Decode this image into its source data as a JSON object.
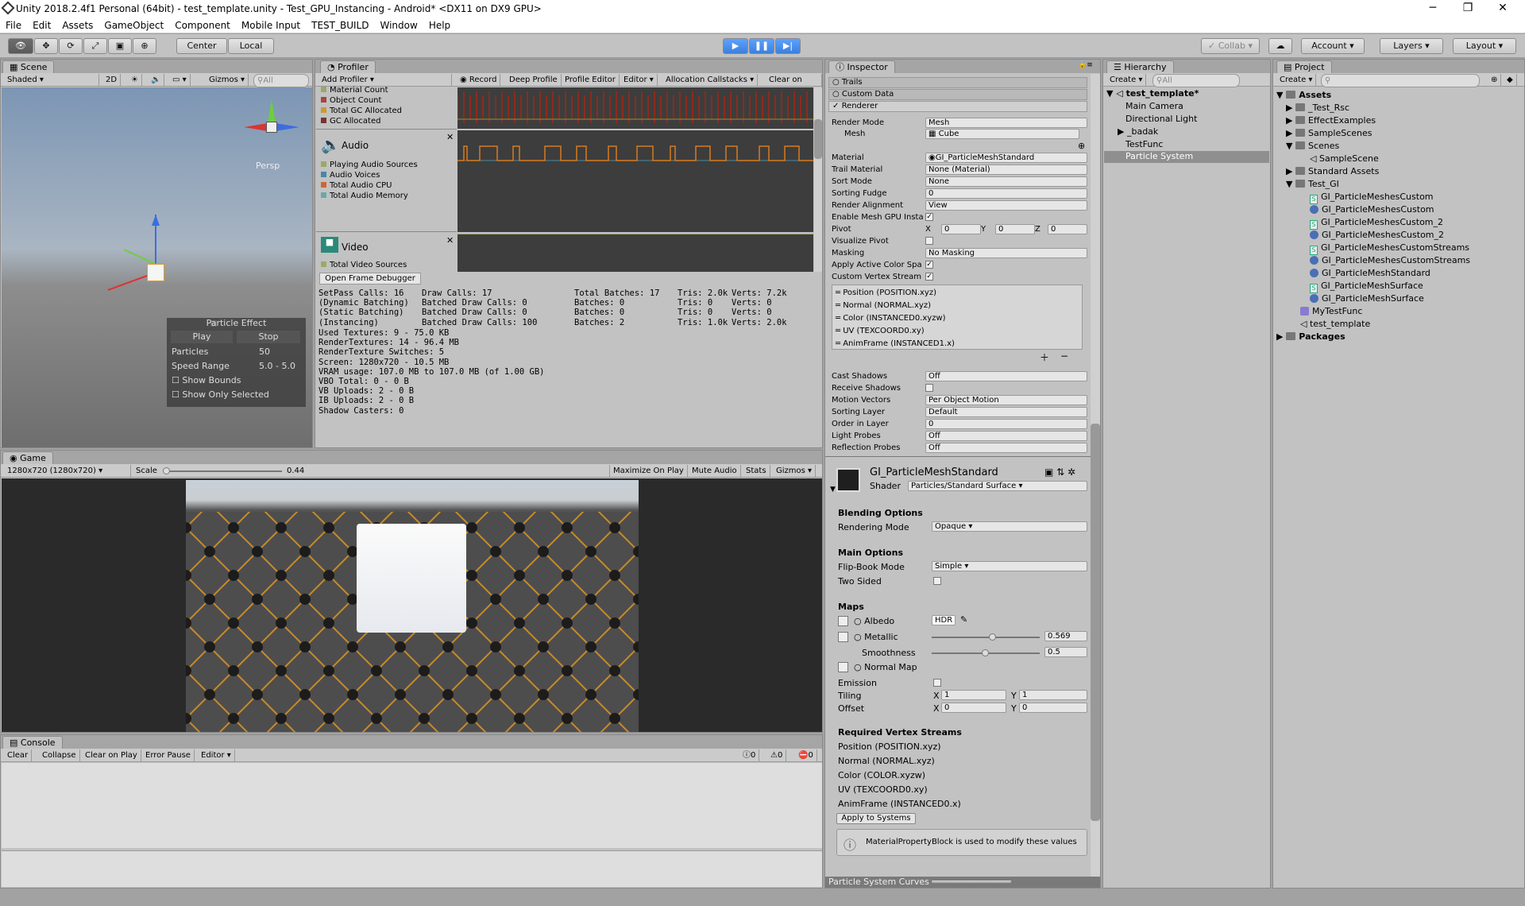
{
  "window": {
    "title": "Unity 2018.2.4f1 Personal (64bit) - test_template.unity - Test_GPU_Instancing - Android* <DX11 on DX9 GPU>"
  },
  "menu": [
    "File",
    "Edit",
    "Assets",
    "GameObject",
    "Component",
    "Mobile Input",
    "TEST_BUILD",
    "Window",
    "Help"
  ],
  "toolbar": {
    "center": "Center",
    "local": "Local",
    "collab": "Collab",
    "account": "Account",
    "layers": "Layers",
    "layout": "Layout"
  },
  "scene": {
    "tab": "Scene",
    "shading": "Shaded",
    "mode2d": "2D",
    "gizmos": "Gizmos",
    "search": "All",
    "persp": "Persp",
    "particle_effect": {
      "title": "Particle Effect",
      "play": "Play",
      "stop": "Stop",
      "particles_label": "Particles",
      "particles_value": "50",
      "speed_label": "Speed Range",
      "speed_value": "5.0 - 5.0",
      "show_bounds": "Show Bounds",
      "show_only": "Show Only Selected"
    }
  },
  "profiler": {
    "tab": "Profiler",
    "add": "Add Profiler",
    "record": "Record",
    "deep": "Deep Profile",
    "editor_btn": "Profile Editor",
    "editor": "Editor",
    "alloc": "Allocation Callstacks",
    "clear": "Clear on Play",
    "memory_items": [
      "Material Count",
      "Object Count",
      "Total GC Allocated",
      "GC Allocated"
    ],
    "audio": "Audio",
    "audio_items": [
      "Playing Audio Sources",
      "Audio Voices",
      "Total Audio CPU",
      "Total Audio Memory"
    ],
    "video": "Video",
    "video_items": [
      "Total Video Sources"
    ],
    "frame_debugger": "Open Frame Debugger",
    "stats_col1": [
      "SetPass Calls: 16",
      "(Dynamic Batching)",
      "(Static Batching)",
      "(Instancing)"
    ],
    "stats_col2": [
      "Draw Calls: 17",
      "Batched Draw Calls: 0",
      "Batched Draw Calls: 0",
      "Batched Draw Calls: 100"
    ],
    "stats_col3": [
      "Total Batches: 17",
      "Batches: 0",
      "Batches: 0",
      "Batches: 2"
    ],
    "stats_col4": [
      "Tris: 2.0k",
      "Tris: 0",
      "Tris: 0",
      "Tris: 1.0k"
    ],
    "stats_col5": [
      "Verts: 7.2k",
      "Verts: 0",
      "Verts: 0",
      "Verts: 2.0k"
    ],
    "stats_more": [
      "Used Textures: 9 - 75.0 KB",
      "RenderTextures: 14 - 96.4 MB",
      "RenderTexture Switches: 5",
      "Screen: 1280x720 - 10.5 MB",
      "VRAM usage: 107.0 MB to 107.0 MB (of 1.00 GB)",
      "VBO Total: 0 - 0 B",
      "VB Uploads: 2 - 0 B",
      "IB Uploads: 2 - 0 B",
      "Shadow Casters: 0"
    ]
  },
  "game": {
    "tab": "Game",
    "resolution": "1280x720 (1280x720)",
    "scale": "Scale",
    "scale_value": "0.44",
    "maximize": "Maximize On Play",
    "mute": "Mute Audio",
    "stats": "Stats",
    "gizmos": "Gizmos"
  },
  "console": {
    "tab": "Console",
    "clear": "Clear",
    "collapse": "Collapse",
    "clear_on_play": "Clear on Play",
    "error_pause": "Error Pause",
    "editor": "Editor",
    "c1": "0",
    "c2": "0",
    "c3": "0"
  },
  "inspector": {
    "tab": "Inspector",
    "modules": [
      "Trails",
      "Custom Data",
      "Renderer"
    ],
    "props": [
      [
        "Render Mode",
        "Mesh"
      ],
      [
        "Mesh",
        "Cube"
      ],
      [
        "Material",
        "GI_ParticleMeshStandard"
      ],
      [
        "Trail Material",
        "None (Material)"
      ],
      [
        "Sort Mode",
        "None"
      ],
      [
        "Sorting Fudge",
        "0"
      ],
      [
        "Render Alignment",
        "View"
      ],
      [
        "Enable Mesh GPU Insta",
        ""
      ],
      [
        "Pivot",
        ""
      ],
      [
        "Visualize Pivot",
        ""
      ],
      [
        "Masking",
        "No Masking"
      ],
      [
        "Apply Active Color Spa",
        ""
      ],
      [
        "Custom Vertex Stream",
        ""
      ]
    ],
    "pivot": {
      "x": "X",
      "xv": "0",
      "y": "Y",
      "yv": "0",
      "z": "Z",
      "zv": "0"
    },
    "streams": [
      "Position (POSITION.xyz)",
      "Normal (NORMAL.xyz)",
      "Color (INSTANCED0.xyzw)",
      "UV (TEXCOORD0.xy)",
      "AnimFrame (INSTANCED1.x)"
    ],
    "props2": [
      [
        "Cast Shadows",
        "Off"
      ],
      [
        "Receive Shadows",
        ""
      ],
      [
        "Motion Vectors",
        "Per Object Motion"
      ],
      [
        "Sorting Layer",
        "Default"
      ],
      [
        "Order in Layer",
        "0"
      ],
      [
        "Light Probes",
        "Off"
      ],
      [
        "Reflection Probes",
        "Off"
      ]
    ],
    "material_name": "GI_ParticleMeshStandard",
    "shader_label": "Shader",
    "shader": "Particles/Standard Surface",
    "blending": "Blending Options",
    "rendering_mode_label": "Rendering Mode",
    "rendering_mode": "Opaque",
    "main_options": "Main Options",
    "flipbook_label": "Flip-Book Mode",
    "flipbook": "Simple",
    "two_sided": "Two Sided",
    "maps": "Maps",
    "albedo": "Albedo",
    "hdr": "HDR",
    "metallic": "Metallic",
    "metallic_value": "0.569",
    "metallic_fraction": 0.569,
    "smoothness": "Smoothness",
    "smoothness_value": "0.5",
    "smoothness_fraction": 0.5,
    "normal_map": "Normal Map",
    "emission": "Emission",
    "tiling": "Tiling",
    "offset": "Offset",
    "tx": "1",
    "ty": "1",
    "ox": "0",
    "oy": "0",
    "req_streams_title": "Required Vertex Streams",
    "req_streams": [
      "Position (POSITION.xyz)",
      "Normal (NORMAL.xyz)",
      "Color (COLOR.xyzw)",
      "UV (TEXCOORD0.xy)",
      "AnimFrame (INSTANCED0.x)"
    ],
    "apply": "Apply to Systems",
    "info": "MaterialPropertyBlock is used to modify these values",
    "curves": "Particle System Curves"
  },
  "hierarchy": {
    "tab": "Hierarchy",
    "create": "Create",
    "search": "All",
    "scene": "test_template*",
    "items": [
      "Main Camera",
      "Directional Light",
      "_badak",
      "TestFunc",
      "Particle System"
    ]
  },
  "project": {
    "tab": "Project",
    "create": "Create",
    "assets": "Assets",
    "folders": [
      "_Test_Rsc",
      "EffectExamples",
      "SampleScenes",
      "Scenes"
    ],
    "sample_scene": "SampleScene",
    "standard": "Standard Assets",
    "test_gi": "Test_GI",
    "files": [
      "GI_ParticleMeshesCustom",
      "GI_ParticleMeshesCustom",
      "GI_ParticleMeshesCustom_2",
      "GI_ParticleMeshesCustom_2",
      "GI_ParticleMeshesCustomStreams",
      "GI_ParticleMeshesCustomStreams",
      "GI_ParticleMeshStandard",
      "GI_ParticleMeshSurface",
      "GI_ParticleMeshSurface"
    ],
    "myfunc": "MyTestFunc",
    "template": "test_template",
    "packages": "Packages"
  }
}
